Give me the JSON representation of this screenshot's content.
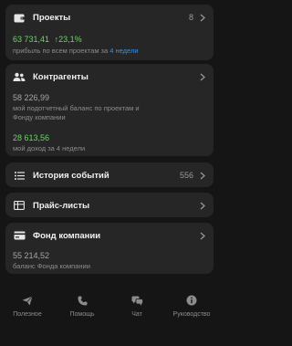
{
  "projects": {
    "title": "Проекты",
    "count": "8",
    "amount": "63 731,41",
    "delta": "↑23,1%",
    "caption_prefix": "прибыль по всем проектам за ",
    "caption_link": "4 недели"
  },
  "counterparties": {
    "title": "Контрагенты",
    "balance_value": "58 226,99",
    "balance_caption_line1": "мой подотчетный баланс по проектам и",
    "balance_caption_line2": "Фонду компании",
    "income_value": "28 613,56",
    "income_caption": "мой доход за 4 недели"
  },
  "history": {
    "title": "История событий",
    "count": "556"
  },
  "pricelists": {
    "title": "Прайс-листы"
  },
  "fund": {
    "title": "Фонд компании",
    "value": "55 214,52",
    "caption": "баланс Фонда компании"
  },
  "tabbar": {
    "items": [
      {
        "label": "Полезное",
        "icon": "send-icon"
      },
      {
        "label": "Помощь",
        "icon": "phone-icon"
      },
      {
        "label": "Чат",
        "icon": "chat-icon"
      },
      {
        "label": "Руководство",
        "icon": "info-icon"
      }
    ]
  },
  "colors": {
    "background": "#151515",
    "card": "#262626",
    "accent_green": "#6ed36a",
    "accent_blue": "#3d8ee8"
  }
}
